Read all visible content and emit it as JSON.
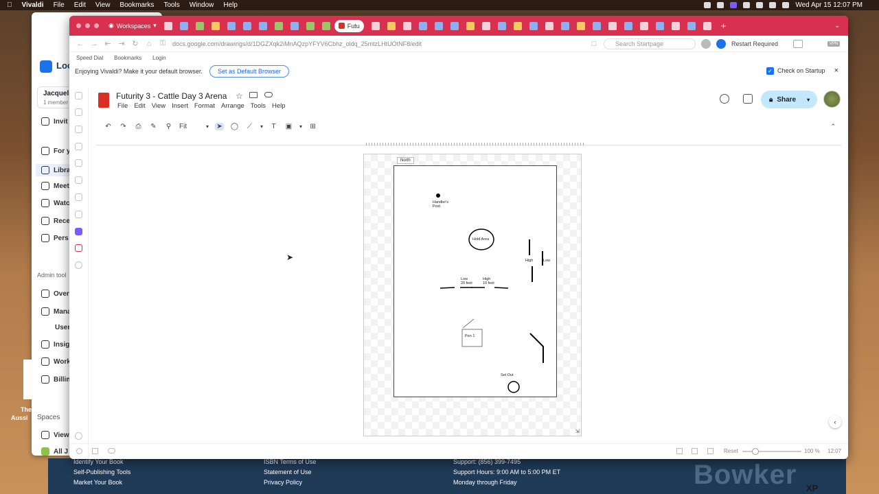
{
  "menubar": {
    "app": "Vivaldi",
    "items": [
      "File",
      "Edit",
      "View",
      "Bookmarks",
      "Tools",
      "Window",
      "Help"
    ],
    "clock": "Wed Apr 15 12:07 PM"
  },
  "bg": {
    "brand": "Loc",
    "user": "Jacqueli",
    "members": "1 member",
    "invite": "Invit",
    "nav": [
      "For y",
      "Libra",
      "Meet",
      "Watc",
      "Rece",
      "Pers"
    ],
    "admin_header": "Admin tool",
    "admin": [
      "Over",
      "Mana",
      "User",
      "Insig",
      "Work",
      "Billin"
    ],
    "spaces": "Spaces",
    "view": "View",
    "all": "All J",
    "the": "The",
    "aussi": "Aussi"
  },
  "bowker": {
    "col1": [
      "Identify Your Book",
      "Self-Publishing Tools",
      "Market Your Book"
    ],
    "col2": [
      "ISBN Terms of Use",
      "Statement of Use",
      "Privacy Policy"
    ],
    "col3": [
      "Support: (856) 399-7495",
      "Support Hours: 9:00 AM to 5:00 PM ET",
      "Monday through Friday"
    ],
    "logo": "Bowker",
    "xp": "XP"
  },
  "browser": {
    "workspace": "Workspaces",
    "active_tab": "Futu",
    "url": "docs.google.com/drawings/d/1DGZXqk2iMnAQzpYFYV6Cbhz_oldq_25mtzLHtUOtNF8/edit",
    "search_placeholder": "Search Startpage",
    "restart": "Restart Required",
    "vpn": "VPN",
    "bookmarks": [
      "Speed Dial",
      "Bookmarks",
      "Login"
    ],
    "notification": "Enjoying Vivaldi? Make it your default browser.",
    "default_btn": "Set as Default Browser",
    "check_startup": "Check on Startup"
  },
  "doc": {
    "title": "Futurity 3 - Cattle Day 3 Arena",
    "menus": [
      "File",
      "Edit",
      "View",
      "Insert",
      "Format",
      "Arrange",
      "Tools",
      "Help"
    ],
    "share": "Share",
    "zoom": "Fit"
  },
  "drawing": {
    "north": "North",
    "handlers_post": "Handler's\nPost",
    "hold_area": "Hold Area",
    "high": "High",
    "low": "Low",
    "low_20": "Low\n20 feet",
    "high_10": "High\n10 feet",
    "pen1": "Pen 1",
    "set_out": "Set Out"
  },
  "status": {
    "reset": "Reset",
    "zoom": "100 %",
    "time": "12:07"
  }
}
